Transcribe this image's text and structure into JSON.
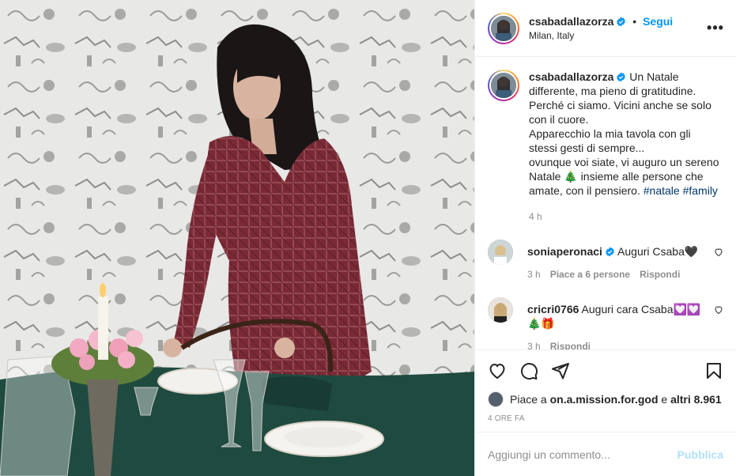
{
  "post": {
    "username": "csabadallazorza",
    "dot": "•",
    "follow_label": "Segui",
    "location": "Milan, Italy",
    "more_label": "•••"
  },
  "caption": {
    "username": "csabadallazorza",
    "lines": [
      "Un Natale",
      "differente, ma pieno di gratitudine.",
      "Perché ci siamo. Vicini anche se solo",
      "con il cuore.",
      "Apparecchio la mia tavola con gli",
      "stessi gesti di sempre...",
      "ovunque voi siate, vi auguro un sereno",
      "Natale 🎄 insieme alle persone che",
      "amate, con il pensiero."
    ],
    "hashtags": [
      "#natale",
      "#family"
    ],
    "time": "4 h"
  },
  "comments": [
    {
      "username": "soniaperonaci",
      "verified": true,
      "text": "Auguri Csaba🖤",
      "time": "3 h",
      "likes_label": "Piace a 6 persone",
      "reply_label": "Rispondi"
    },
    {
      "username": "cricri0766",
      "verified": false,
      "text": "Auguri cara Csaba💟💟🎄🎁",
      "time": "3 h",
      "reply_label": "Rispondi"
    }
  ],
  "likes": {
    "prefix": "Piace a",
    "user": "on.a.mission.for.god",
    "middle": "e",
    "others": "altri 8.961"
  },
  "date_label": "4 ORE FA",
  "add_comment": {
    "placeholder": "Aggiungi un commento...",
    "publish_label": "Pubblica"
  },
  "colors": {
    "accent": "#0095f6",
    "link": "#00376b",
    "muted": "#8e8e8e",
    "publish_disabled": "#b2dffc",
    "dress": "#7a2a35",
    "tablecloth": "#1f4a3f"
  }
}
